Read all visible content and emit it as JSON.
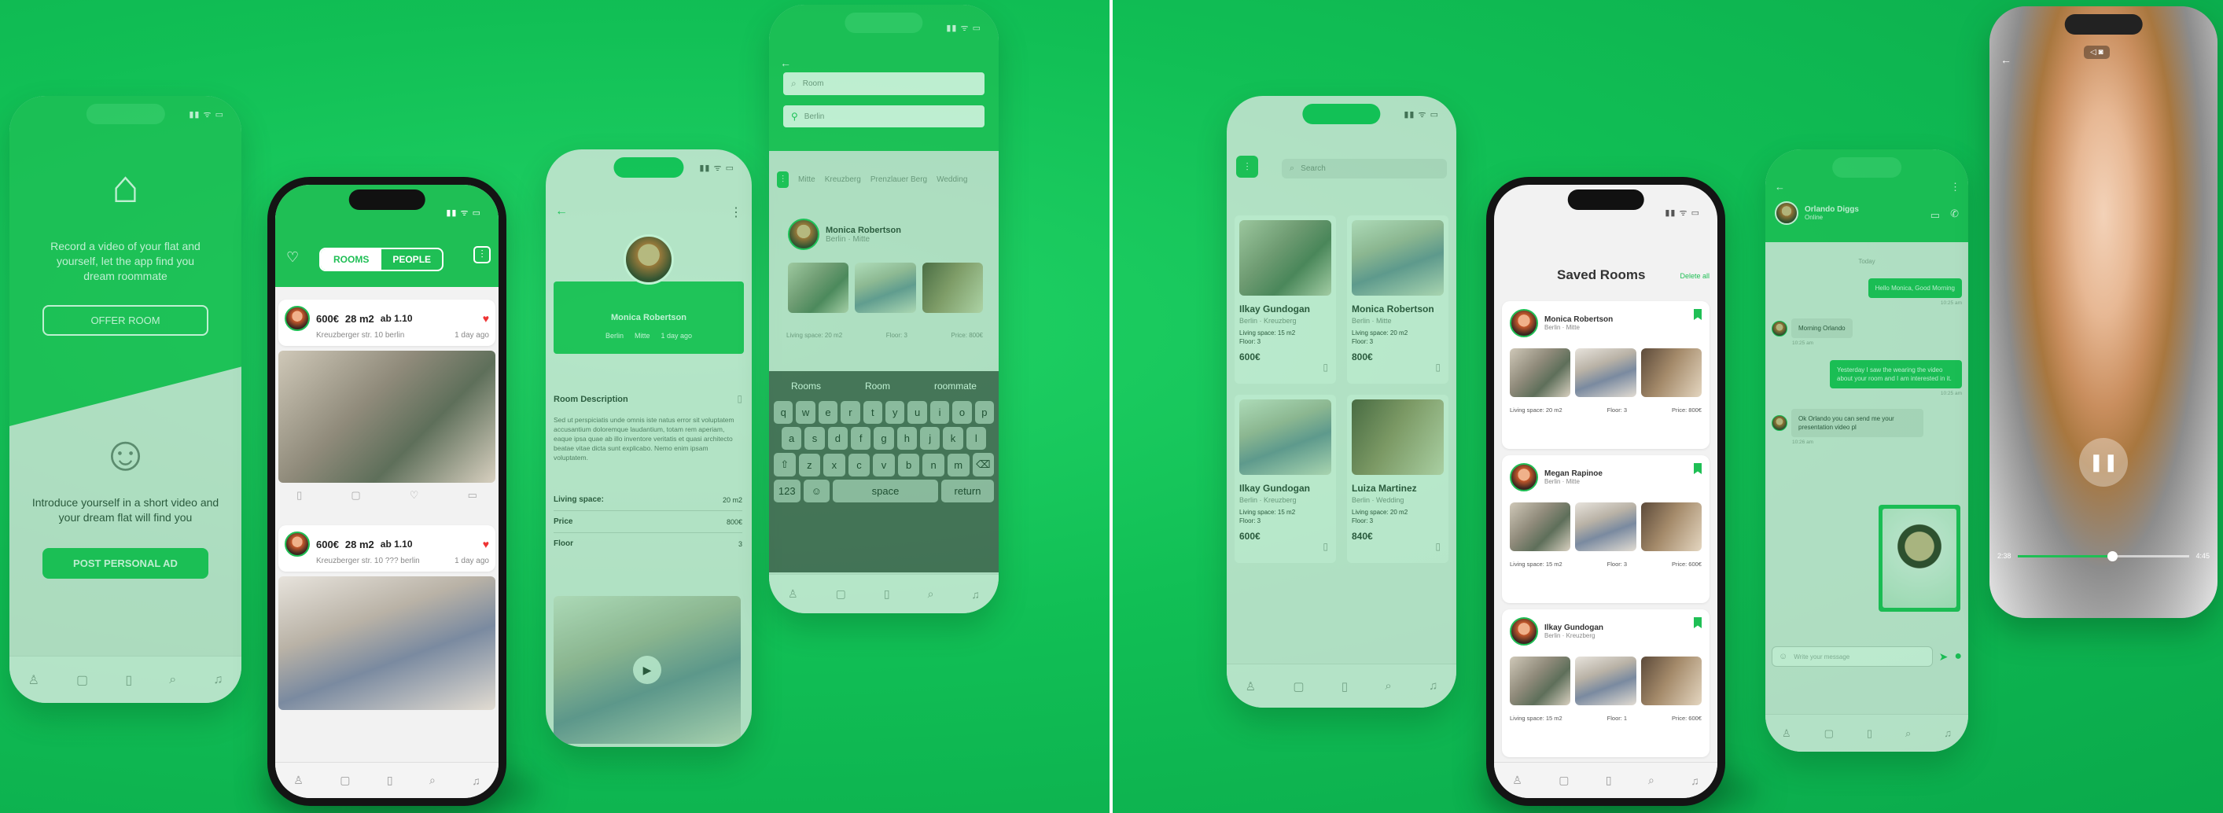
{
  "colors": {
    "accent": "#1fbf55",
    "background": "#13c257"
  },
  "icons": {
    "home": "⌂",
    "smile": "☺",
    "heart": "♡",
    "back": "←",
    "more": "⋮",
    "search": "⌕",
    "pin": "⚲",
    "filter": "⫶",
    "bookmark": "▮",
    "video": "▭",
    "phone": "✆",
    "send": "➤",
    "mic": "●",
    "pause": "❚❚",
    "user": "♙",
    "chat": "▢",
    "save": "▯",
    "bell": "♫"
  },
  "onboarding": {
    "offer_text": "Record a video of your flat and yourself, let the app find you dream roommate",
    "offer_button": "OFFER ROOM",
    "personal_text": "Introduce yourself in a short video and your dream flat will find you",
    "personal_button": "POST PERSONAL AD"
  },
  "feed": {
    "tabs": [
      "ROOMS",
      "PEOPLE"
    ],
    "listings": [
      {
        "price": "600€",
        "size": "28 m2",
        "from": "ab 1.10",
        "meta": "Kreuzberger str. 10 berlin",
        "ago": "1 day ago"
      },
      {
        "price": "600€",
        "size": "28 m2",
        "from": "ab 1.10",
        "meta": "Kreuzberger str. 10 ??? berlin",
        "ago": "1 day ago"
      }
    ]
  },
  "profile": {
    "name": "Monica Robertson",
    "location": "Berlin",
    "district": "Mitte",
    "ago": "1 day ago",
    "section_title": "Room Description",
    "description": "Sed ut perspiciatis unde omnis iste natus error sit voluptatem accusantium doloremque laudantium, totam rem aperiam, eaque ipsa quae ab illo inventore veritatis et quasi architecto beatae vitae dicta sunt explicabo. Nemo enim ipsam voluptatem.",
    "details": [
      {
        "label": "Living space:",
        "value": "20 m2"
      },
      {
        "label": "Price",
        "value": "800€"
      },
      {
        "label": "Floor",
        "value": "3"
      }
    ]
  },
  "search": {
    "room_placeholder": "Room",
    "city_placeholder": "Berlin",
    "chips": [
      "Mitte",
      "Kreuzberg",
      "Prenzlauer Berg",
      "Wedding"
    ],
    "result_name": "Monica Robertson",
    "result_meta": "Berlin · Mitte",
    "result_stats": [
      "Living space: 20 m2",
      "Floor: 3",
      "Price: 800€"
    ],
    "suggestions": [
      "Rooms",
      "Room",
      "roommate"
    ],
    "keyboard_rows": [
      [
        "q",
        "w",
        "e",
        "r",
        "t",
        "y",
        "u",
        "i",
        "o",
        "p"
      ],
      [
        "a",
        "s",
        "d",
        "f",
        "g",
        "h",
        "j",
        "k",
        "l"
      ],
      [
        "⇧",
        "z",
        "x",
        "c",
        "v",
        "b",
        "n",
        "m",
        "⌫"
      ]
    ],
    "key_123": "123",
    "key_space": "space",
    "key_return": "return"
  },
  "grid": {
    "search_placeholder": "Search",
    "cards": [
      {
        "name": "Ilkay Gundogan",
        "loc": "Berlin · Kreuzberg",
        "space": "Living space: 15 m2",
        "floor": "Floor: 3",
        "price": "600€"
      },
      {
        "name": "Monica Robertson",
        "loc": "Berlin · Mitte",
        "space": "Living space: 20 m2",
        "floor": "Floor: 3",
        "price": "800€"
      },
      {
        "name": "Ilkay Gundogan",
        "loc": "Berlin · Kreuzberg",
        "space": "Living space: 15 m2",
        "floor": "Floor: 3",
        "price": "600€"
      },
      {
        "name": "Luiza Martinez",
        "loc": "Berlin · Wedding",
        "space": "Living space: 20 m2",
        "floor": "Floor: 3",
        "price": "840€"
      }
    ]
  },
  "saved": {
    "title": "Saved Rooms",
    "edit": "Delete all",
    "items": [
      {
        "name": "Monica Robertson",
        "loc": "Berlin · Mitte",
        "stats": [
          "Living space: 20 m2",
          "Floor: 3",
          "Price: 800€"
        ]
      },
      {
        "name": "Megan Rapinoe",
        "loc": "Berlin · Mitte",
        "stats": [
          "Living space: 15 m2",
          "Floor: 3",
          "Price: 600€"
        ]
      },
      {
        "name": "Ilkay Gundogan",
        "loc": "Berlin · Kreuzberg",
        "stats": [
          "Living space: 15 m2",
          "Floor: 1",
          "Price: 600€"
        ]
      }
    ]
  },
  "chat": {
    "contact": "Orlando Diggs",
    "status": "Online",
    "day": "Today",
    "messages": [
      {
        "from": "me",
        "text": "Hello Monica, Good Morning",
        "time": "10:25 am"
      },
      {
        "from": "them",
        "text": "Morning Orlando",
        "time": "10:25 am"
      },
      {
        "from": "me",
        "text": "Yesterday I saw the wearing the video about your room and I am interested in it.",
        "time": "10:25 am"
      },
      {
        "from": "them",
        "text": "Ok Orlando you can send me your presentation video pl",
        "time": "10:26 am"
      }
    ],
    "input_placeholder": "Write your message"
  },
  "video": {
    "elapsed": "2:38",
    "total": "4:45",
    "progress": 0.55
  }
}
